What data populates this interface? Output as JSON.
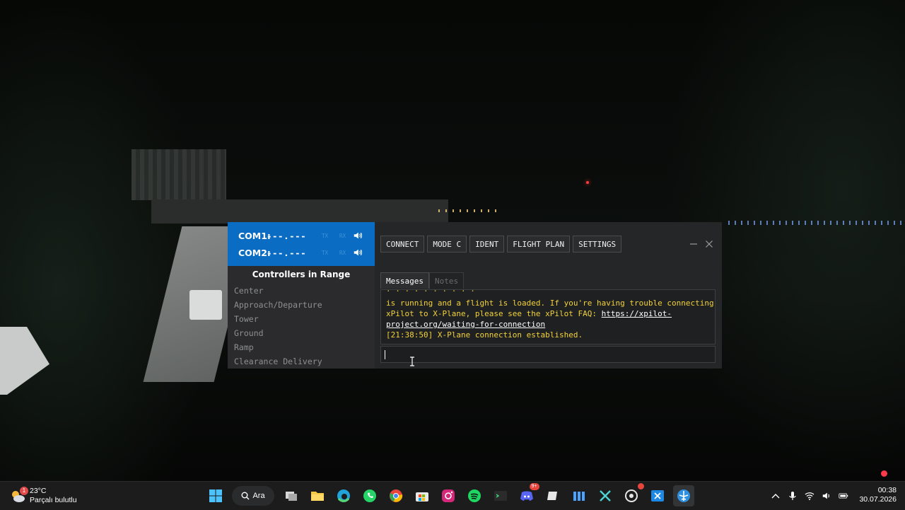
{
  "radio": {
    "com1": {
      "label": "COM1:",
      "freq": "---.---",
      "tx": "TX",
      "rx": "RX"
    },
    "com2": {
      "label": "COM2:",
      "freq": "---.---",
      "tx": "TX",
      "rx": "RX"
    }
  },
  "toolbar": {
    "connect": "CONNECT",
    "mode_c": "MODE C",
    "ident": "IDENT",
    "flight_plan": "FLIGHT PLAN",
    "settings": "SETTINGS"
  },
  "controllers": {
    "title": "Controllers in Range",
    "items": [
      "Center",
      "Approach/Departure",
      "Tower",
      "Ground",
      "Ramp",
      "Clearance Delivery"
    ]
  },
  "tabs": {
    "messages": "Messages",
    "notes": "Notes"
  },
  "messages": {
    "line1": "is running and a flight is loaded. If you're having trouble connecting",
    "line2_text": "xPilot to X-Plane, please see the xPilot FAQ: ",
    "line2_link": "https://xpilot-",
    "line3_link": "project.org/waiting-for-connection",
    "line4": "[21:38:50] X-Plane connection established."
  },
  "input": {
    "value": ""
  },
  "taskbar": {
    "weather_temp": "23°C",
    "weather_desc": "Parçalı bulutlu",
    "weather_badge": "1",
    "search_label": "Ara",
    "clock_time": "00:38",
    "clock_date": "30.07.2026",
    "discord_badge": "9+"
  },
  "colors": {
    "radio_panel": "#0a6cc2",
    "message_text": "#f3d23a",
    "window_bg": "#252627"
  }
}
